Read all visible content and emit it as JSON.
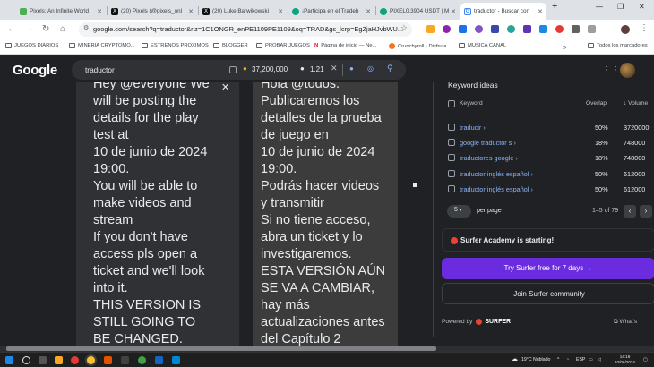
{
  "tabs": [
    {
      "label": "Pixels: An Infinite World",
      "icon": "pixels-icon",
      "color": "#4caf50"
    },
    {
      "label": "(20) Pixels (@pixels_onl",
      "icon": "x-icon",
      "color": "#000000"
    },
    {
      "label": "(20) Luke Barwikowski",
      "icon": "x-icon",
      "color": "#000000"
    },
    {
      "label": "¡Participa en el Tradeb",
      "icon": "chatgpt-icon",
      "color": "#10a37f"
    },
    {
      "label": "PIXEL0.3904 USDT | M",
      "icon": "chatgpt-icon",
      "color": "#10a37f"
    },
    {
      "label": "traductor - Buscar con",
      "icon": "google-icon",
      "color": "#4285f4",
      "active": true
    }
  ],
  "new_tab": "+",
  "url": "google.com/search?q=traductor&rlz=1C1ONGR_enPE1109PE1109&oq=TRAD&gs_lcrp=EgZjaHJvbWU...",
  "bookmarks": [
    "JUEGOS DIARIOS",
    "MINERIA CRYPTOMO...",
    "ESTRENOS PROXIMOS",
    "BLOGGER",
    "PROBAR JUEGOS",
    "Página de inicio — Ne...",
    "Crunchyroll - Disfruta...",
    "MUSICA CANAL",
    "Todos los marcadores"
  ],
  "google": {
    "logo": "Google",
    "query": "traductor",
    "count": "37,200,000",
    "cpc": "1.21"
  },
  "translator": {
    "source_lines": "Hey @everyone We\nwill be posting the\ndetails for the play\ntest at\n10 de junio de 2024\n19:00.\nYou will be able to\nmake videos and\nstream\nIf you don't have\naccess pls open a\nticket and we'll look\ninto it.\nTHIS VERSION IS\nSTILL GOING TO\nBE CHANGED.",
    "target_lines": "Hola @todos.\nPublicaremos los\ndetalles de la prueba\nde juego en\n10 de junio de 2024\n19:00.\nPodrás hacer videos\ny transmitir\nSi no tiene acceso,\nabra un ticket y lo\ninvestigaremos.\nESTA VERSIÓN AÚN\nSE VA A CAMBIAR,\nhay más\nactualizaciones antes\ndel Capítulo 2"
  },
  "surfer": {
    "title": "Keyword ideas",
    "headers": {
      "keyword": "Keyword",
      "overlap": "Overlap",
      "volume": "↓ Volume"
    },
    "rows": [
      {
        "keyword": "traducir ›",
        "overlap": "50%",
        "volume": "3720000"
      },
      {
        "keyword": "google traductor s ›",
        "overlap": "18%",
        "volume": "748000"
      },
      {
        "keyword": "traductores google ›",
        "overlap": "18%",
        "volume": "748000"
      },
      {
        "keyword": "traductor inglés español ›",
        "overlap": "50%",
        "volume": "612000"
      },
      {
        "keyword": "traductor inglés español ›",
        "overlap": "50%",
        "volume": "612000"
      }
    ],
    "per_page_value": "5",
    "per_page_label": "per page",
    "range": "1–5 of 79",
    "academy": "Surfer Academy is starting!",
    "try_free": "Try Surfer free for 7 days →",
    "community": "Join Surfer community",
    "powered_by": "Powered by",
    "brand": "SURFER",
    "whats_new": "What's"
  },
  "taskbar": {
    "weather": "19°C  Nublado",
    "lang": "ESP",
    "time": "14:18",
    "date": "10/06/2024"
  }
}
